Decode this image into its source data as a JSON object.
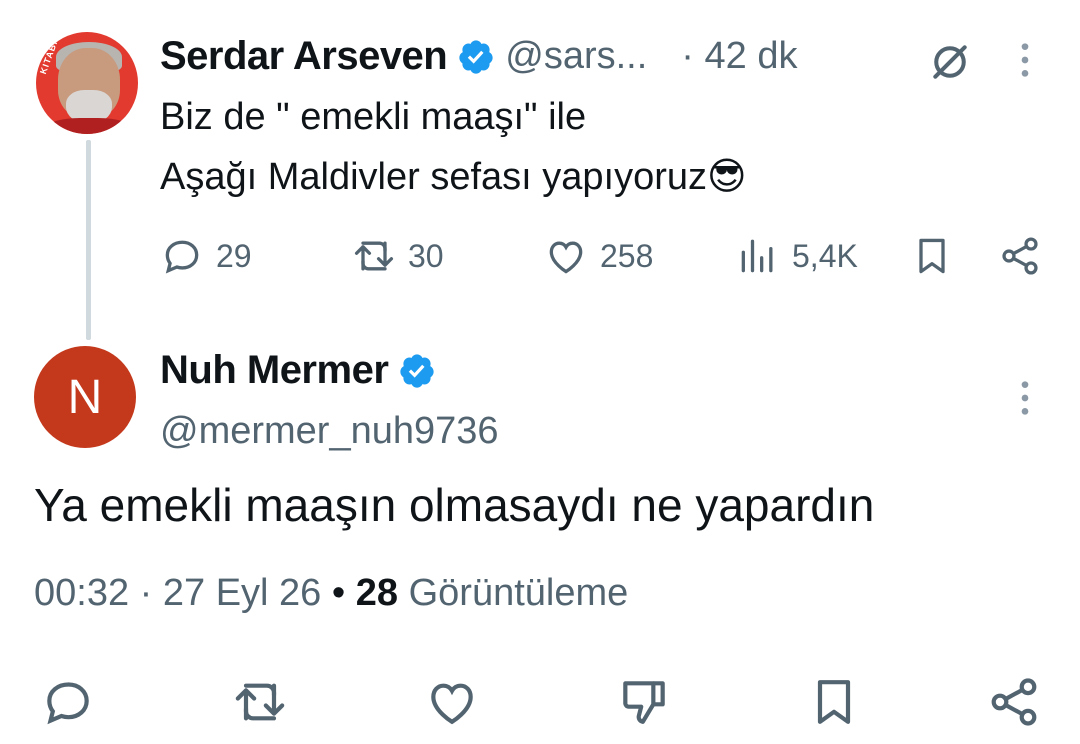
{
  "parent_tweet": {
    "author_name": "Serdar Arseven",
    "handle": "@sars...",
    "time": "· 42 dk",
    "text_line1": "Biz de \" emekli maaşı\" ile",
    "text_line2": "Aşağı Maldivler sefası yapıyoruz😎",
    "avatar_ring_text": "KITABIN ORTASI",
    "stats": {
      "replies": "29",
      "retweets": "30",
      "likes": "258",
      "views": "5,4K"
    }
  },
  "reply_tweet": {
    "author_name": "Nuh Mermer",
    "avatar_initial": "N",
    "handle": "@mermer_nuh9736",
    "text": "Ya emekli maaşın olmasaydı ne yapardın",
    "time": "00:32",
    "date": "27 Eyl 26",
    "view_count": "28",
    "view_label": "Görüntüleme"
  },
  "colors": {
    "verified": "#1d9bf0",
    "secondary_text": "#536471",
    "avatar_n": "#c4391c"
  },
  "icons": {
    "reply": "reply-icon",
    "retweet": "retweet-icon",
    "like": "heart-icon",
    "views": "views-icon",
    "bookmark": "bookmark-icon",
    "share": "share-icon",
    "dislike": "thumbs-down-icon",
    "more": "more-icon",
    "grok": "grok-icon"
  }
}
